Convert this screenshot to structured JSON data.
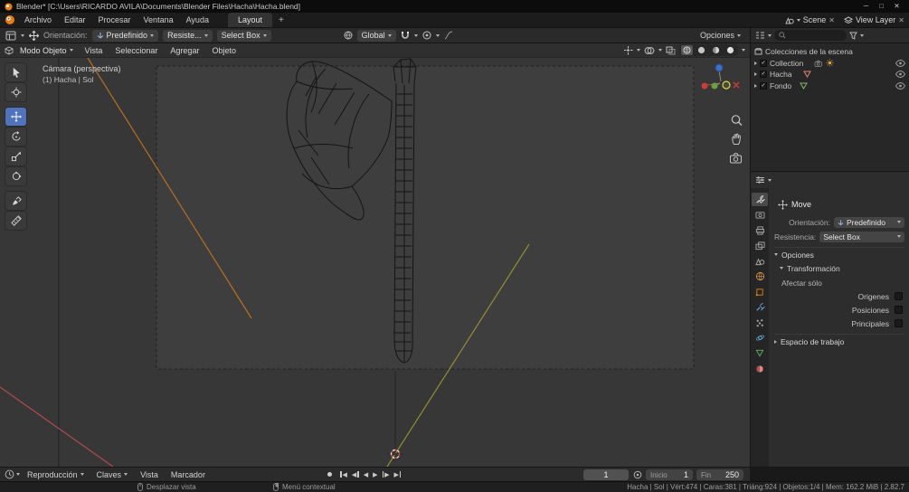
{
  "window": {
    "title": "Blender* [C:\\Users\\RICARDO AVILA\\Documents\\Blender Files\\Hacha\\Hacha.blend]"
  },
  "menubar": {
    "menus": [
      "Archivo",
      "Editar",
      "Procesar",
      "Ventana",
      "Ayuda"
    ],
    "workspace_tab": "Layout",
    "add_tab": "+",
    "scene_name": "Scene",
    "view_layer_name": "View Layer"
  },
  "tool_settings": {
    "orientation_label": "Orientación:",
    "orientation_value": "Predefinido",
    "resist_value": "Resiste...",
    "select_box": "Select Box",
    "pivot": "Global",
    "options": "Opciones"
  },
  "viewport": {
    "mode": "Modo Objeto",
    "menus": [
      "Vista",
      "Seleccionar",
      "Agregar",
      "Objeto"
    ],
    "camera_label": "Cámara (perspectiva)",
    "active_object_label": "(1) Hacha | Sol"
  },
  "outliner": {
    "scene_collection": "Colecciones de la escena",
    "items": [
      {
        "name": "Collection"
      },
      {
        "name": "Hacha"
      },
      {
        "name": "Fondo"
      }
    ]
  },
  "tool_panel": {
    "title": "Move",
    "orientation_label": "Orientación:",
    "orientation_value": "Predefinido",
    "resist_label": "Resistencia:",
    "resist_value": "Select Box",
    "options_section": "Opciones",
    "transform_section": "Transformación",
    "affect_only_label": "Afectar sólo",
    "checkbox_labels": [
      "Origenes",
      "Posiciones",
      "Principales"
    ],
    "workspace_section": "Espacio de trabajo"
  },
  "timeline": {
    "menus": [
      "Reproducción",
      "Claves",
      "Vista",
      "Marcador"
    ],
    "current_frame": "1",
    "start_label": "Inicio",
    "start_value": "1",
    "end_label": "Fin",
    "end_value": "250"
  },
  "statusbar": {
    "left_hint": "Desplazar vista",
    "middle_hint": "Menú contextual",
    "stats": "Hacha | Sol | Vért:474 | Caras:381 | Triáng:924 | Objetos:1/4 | Mem: 162.2 MiB | 2.82.7"
  }
}
